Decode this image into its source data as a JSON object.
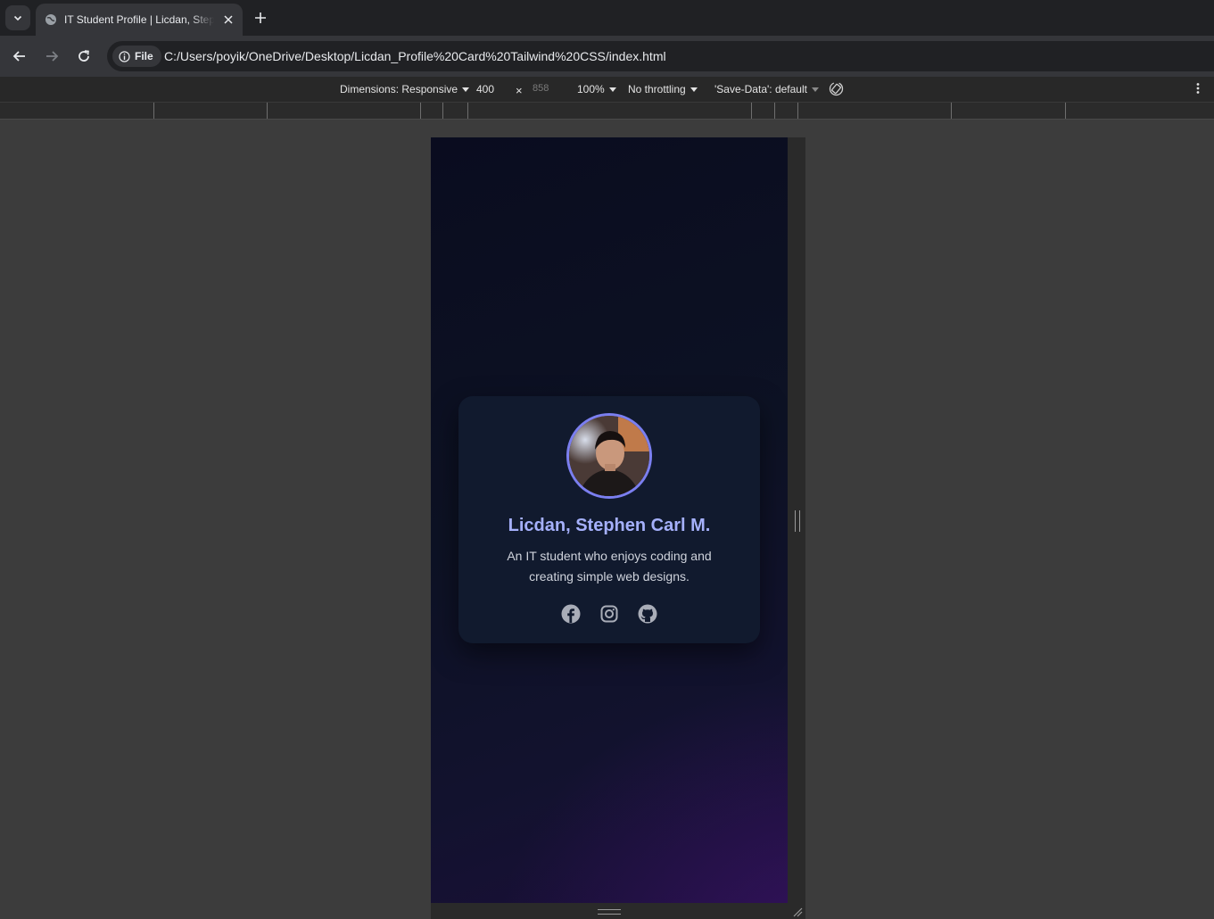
{
  "browser": {
    "tab_title": "IT Student Profile | Licdan, Stephen Carl M.",
    "site_chip_label": "File",
    "url": "C:/Users/poyik/OneDrive/Desktop/Licdan_Profile%20Card%20Tailwind%20CSS/index.html"
  },
  "devtools": {
    "dimensions_label": "Dimensions: Responsive",
    "width": "400",
    "times": "×",
    "height": "858",
    "zoom": "100%",
    "throttling": "No throttling",
    "save_data": "'Save-Data': default"
  },
  "profile": {
    "name": "Licdan, Stephen Carl M.",
    "bio": "An IT student who enjoys coding and creating simple web designs.",
    "socials": [
      "facebook-icon",
      "instagram-icon",
      "github-icon"
    ]
  },
  "colors": {
    "accent": "#a5b0fb",
    "avatar_ring": "#7b7ff0",
    "card_bg": "#111a2e",
    "page_bg": "#0d1224"
  }
}
